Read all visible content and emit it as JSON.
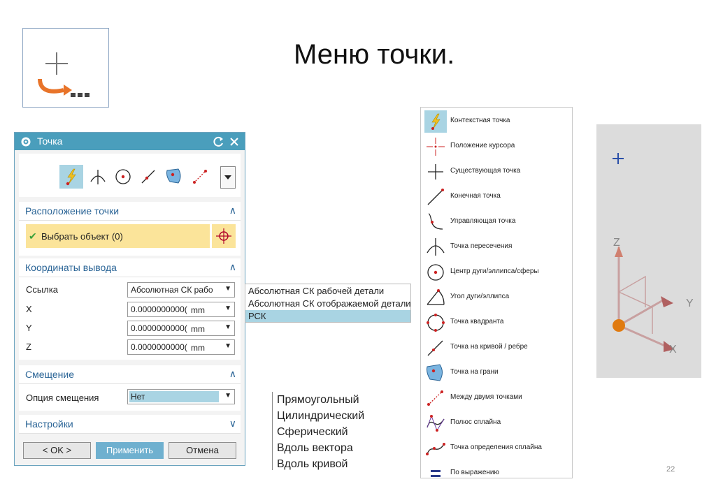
{
  "slide": {
    "title": "Меню точки.",
    "page_number": "22"
  },
  "dialog": {
    "title": "Точка",
    "sections": {
      "location": {
        "title": "Расположение точки",
        "select_object": "Выбрать объект (0)"
      },
      "output": {
        "title": "Координаты вывода",
        "reference_label": "Ссылка",
        "reference_value": "Абсолютная СК рабо",
        "x_label": "X",
        "x_value": "0.0000000000(",
        "x_unit": "mm",
        "y_label": "Y",
        "y_value": "0.0000000000(",
        "y_unit": "mm",
        "z_label": "Z",
        "z_value": "0.0000000000(",
        "z_unit": "mm"
      },
      "offset": {
        "title": "Смещение",
        "option_label": "Опция смещения",
        "option_value": "Нет"
      },
      "settings": {
        "title": "Настройки"
      }
    },
    "buttons": {
      "ok": "< OK >",
      "apply": "Применить",
      "cancel": "Отмена"
    }
  },
  "reference_options": [
    "Абсолютная СК рабочей детали",
    "Абсолютная СК отображаемой детали",
    "РСК"
  ],
  "offset_options": [
    "Прямоугольный",
    "Цилиндрический",
    "Сферический",
    "Вдоль вектора",
    "Вдоль кривой"
  ],
  "point_types": [
    {
      "label": "Контекстная точка",
      "icon": "lightning-point-icon"
    },
    {
      "label": "Положение курсора",
      "icon": "cursor-position-icon"
    },
    {
      "label": "Существующая точка",
      "icon": "existing-point-icon"
    },
    {
      "label": "Конечная точка",
      "icon": "end-point-icon"
    },
    {
      "label": "Управляющая точка",
      "icon": "control-point-icon"
    },
    {
      "label": "Точка пересечения",
      "icon": "intersection-point-icon"
    },
    {
      "label": "Центр дуги/эллипса/сферы",
      "icon": "arc-center-icon"
    },
    {
      "label": "Угол дуги/эллипса",
      "icon": "arc-angle-icon"
    },
    {
      "label": "Точка квадранта",
      "icon": "quadrant-point-icon"
    },
    {
      "label": "Точка на кривой / ребре",
      "icon": "point-on-curve-icon"
    },
    {
      "label": "Точка на грани",
      "icon": "point-on-face-icon"
    },
    {
      "label": "Между двумя точками",
      "icon": "between-points-icon"
    },
    {
      "label": "Полюс сплайна",
      "icon": "spline-pole-icon"
    },
    {
      "label": "Точка определения сплайна",
      "icon": "spline-defining-point-icon"
    },
    {
      "label": "По выражению",
      "icon": "expression-icon"
    }
  ],
  "viewport": {
    "axis_x": "X",
    "axis_y": "Y",
    "axis_z": "Z"
  },
  "colors": {
    "dialog_header": "#4a9ebc",
    "selection_highlight": "#a9d4e3",
    "selected_field": "#fbe49a",
    "accent_red": "#cc2222"
  }
}
